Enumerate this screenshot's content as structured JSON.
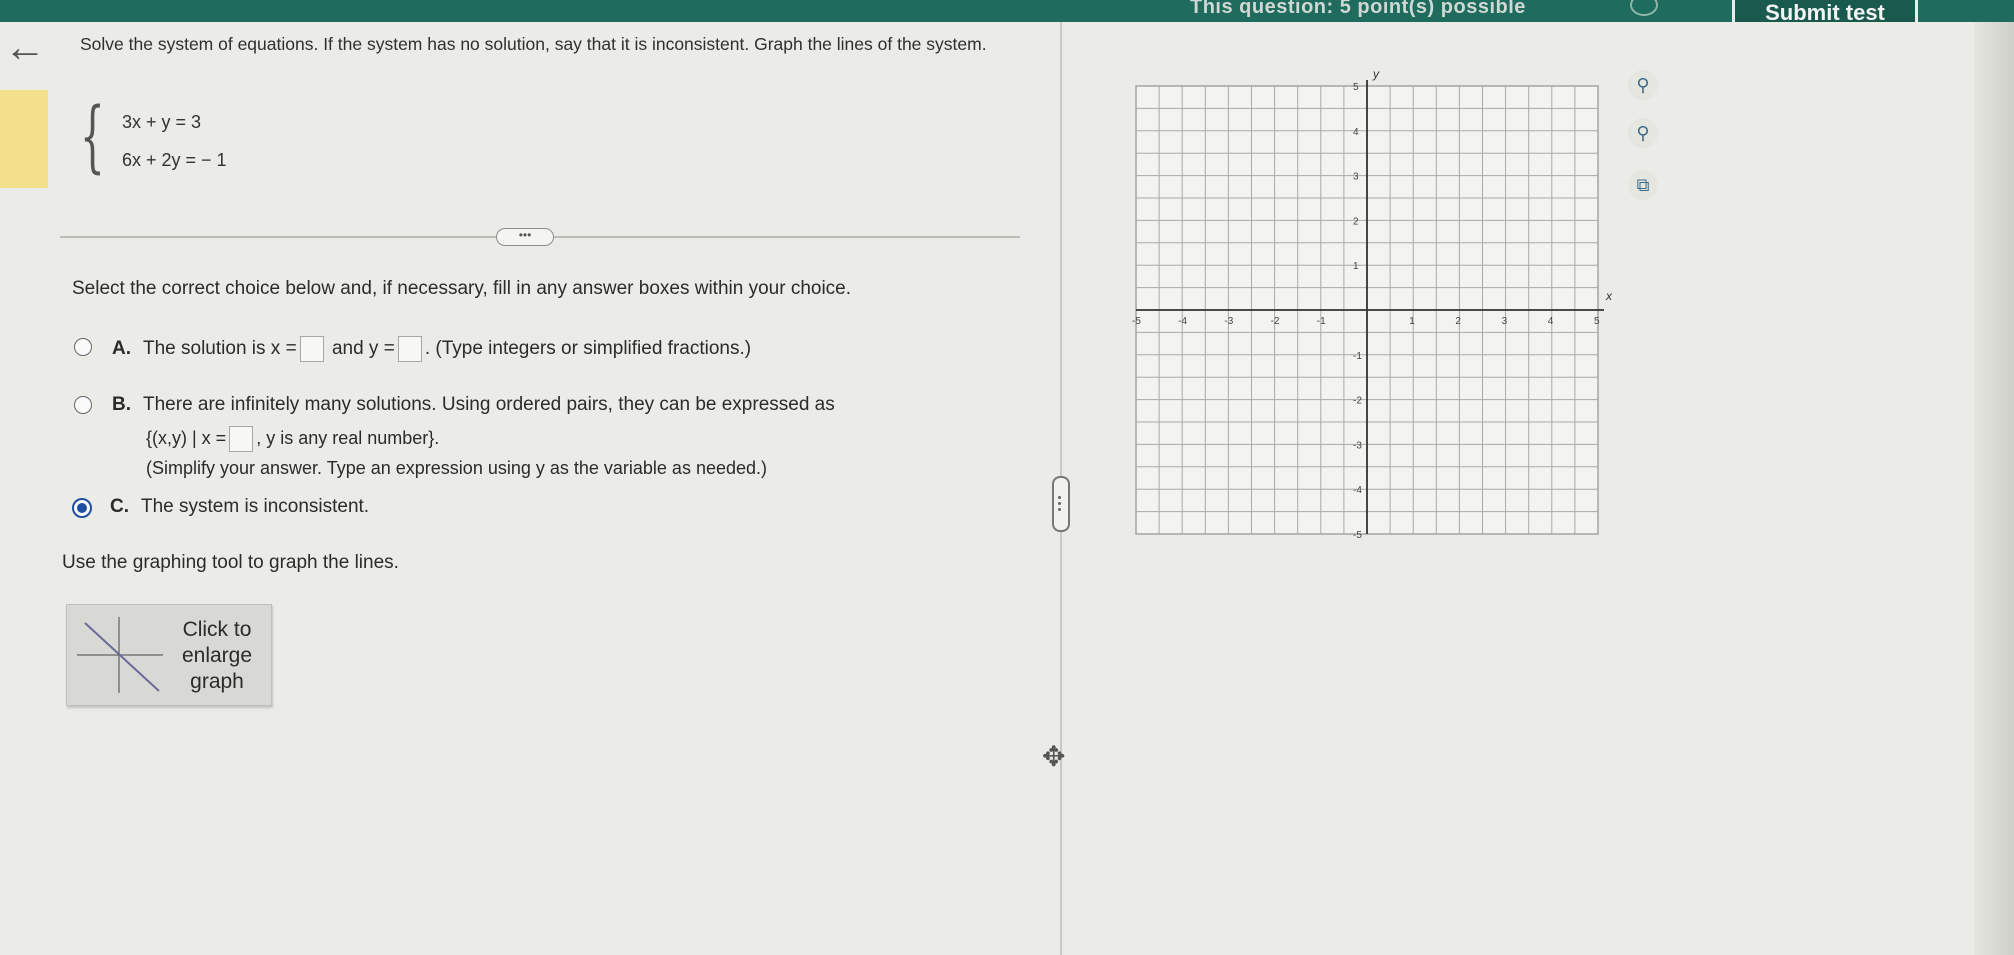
{
  "header": {
    "question_info": "This question: 5 point(s) possible",
    "submit_label": "Submit test"
  },
  "problem": {
    "prompt": "Solve the system of equations. If the system has no solution, say that it is inconsistent. Graph the lines of the system.",
    "equations": [
      "3x + y  = 3",
      "6x + 2y = − 1"
    ]
  },
  "instruction": "Select the correct choice below and, if necessary, fill in any answer boxes within your choice.",
  "choices": [
    {
      "letter": "A.",
      "text_before": "The solution is x =",
      "text_mid": "and y =",
      "text_after": ". (Type integers or simplified fractions.)",
      "selected": false
    },
    {
      "letter": "B.",
      "text": "There are infinitely many solutions. Using ordered pairs, they can be expressed as",
      "set_open": "{(x,y) | x =",
      "set_close": ", y is any real number}.",
      "note": "(Simplify your answer. Type an expression using y as the variable as needed.)",
      "selected": false
    },
    {
      "letter": "C.",
      "text": "The system is inconsistent.",
      "selected": true
    }
  ],
  "graph_prompt": "Use the graphing tool to graph the lines.",
  "enlarge_label": "Click to enlarge graph",
  "graph": {
    "x_range": [
      -5,
      5
    ],
    "y_range": [
      -5,
      5
    ],
    "x_axis_label": "x",
    "y_axis_label": "y",
    "tick_labels": [
      "-5",
      "-4",
      "-3",
      "-2",
      "-1",
      "1",
      "2",
      "3",
      "4",
      "5"
    ]
  },
  "tools": [
    "zoom-in-icon",
    "zoom-out-icon",
    "external-link-icon"
  ]
}
